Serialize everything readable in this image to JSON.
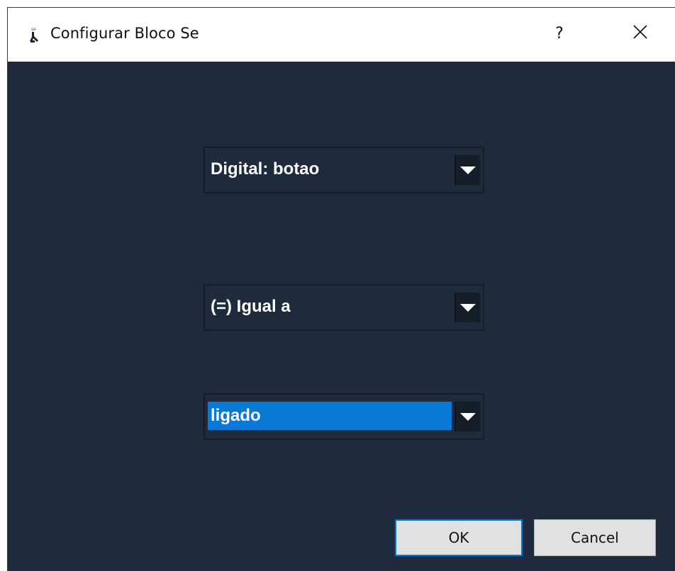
{
  "window": {
    "title": "Configurar Bloco Se",
    "help_label": "?",
    "icon": "app-icon",
    "close_icon": "close-icon"
  },
  "fields": {
    "sensor": {
      "value": "Digital: botao"
    },
    "operator": {
      "value": "(=) Igual a"
    },
    "state": {
      "value": "ligado",
      "selected": true
    }
  },
  "buttons": {
    "ok_label": "OK",
    "cancel_label": "Cancel"
  },
  "colors": {
    "background": "#1f2a3c",
    "selection": "#0a78d7",
    "default_button_border": "#0078d7"
  }
}
